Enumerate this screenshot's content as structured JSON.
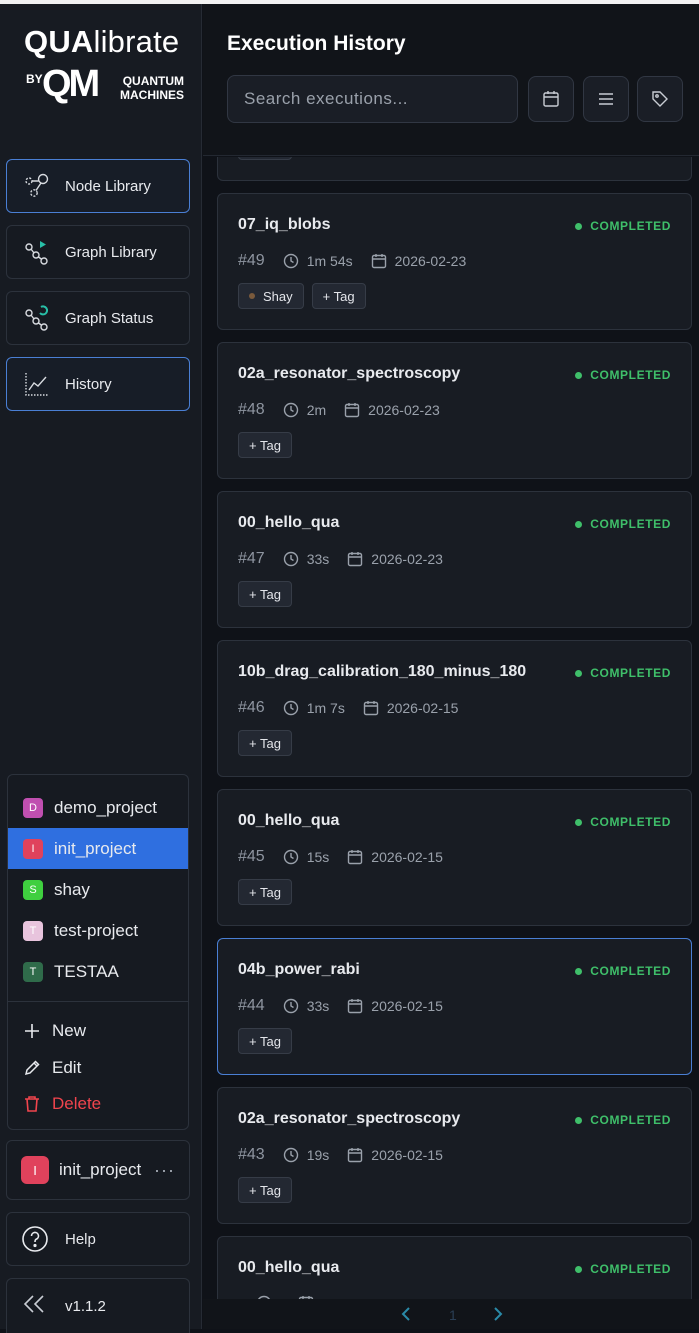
{
  "app": {
    "logo_main_bold": "QUA",
    "logo_main_rest": "librate",
    "logo_by": "BY",
    "logo_mark": "QM",
    "logo_sub_1": "QUANTUM",
    "logo_sub_2": "MACHINES",
    "version": "v1.1.2"
  },
  "nav": [
    {
      "label": "Node Library",
      "icon": "node-library-icon",
      "active": true
    },
    {
      "label": "Graph Library",
      "icon": "graph-library-icon",
      "active": false
    },
    {
      "label": "Graph Status",
      "icon": "graph-status-icon",
      "active": false
    },
    {
      "label": "History",
      "icon": "history-chart-icon",
      "active": true
    }
  ],
  "projects": {
    "items": [
      {
        "letter": "D",
        "name": "demo_project",
        "color": "#c04fb0"
      },
      {
        "letter": "I",
        "name": "init_project",
        "color": "#e0425c",
        "selected": true
      },
      {
        "letter": "S",
        "name": "shay",
        "color": "#3fcf3f"
      },
      {
        "letter": "T",
        "name": "test-project",
        "color": "#e8c4dd"
      },
      {
        "letter": "T",
        "name": "TESTAA",
        "color": "#2f6b4a"
      }
    ],
    "actions": {
      "new": "New",
      "edit": "Edit",
      "delete": "Delete"
    },
    "current": {
      "letter": "I",
      "name": "init_project",
      "color": "#e0425c",
      "more": "···"
    }
  },
  "help_label": "Help",
  "header": {
    "title": "Execution History",
    "search_placeholder": "Search executions..."
  },
  "executions": [
    {
      "name": "07_iq_blobs",
      "status": "COMPLETED",
      "number": "#49",
      "duration": "1m 54s",
      "date": "2026-02-23",
      "tags": [
        "Shay"
      ],
      "add_tag": "+ Tag"
    },
    {
      "name": "02a_resonator_spectroscopy",
      "status": "COMPLETED",
      "number": "#48",
      "duration": "2m",
      "date": "2026-02-23",
      "tags": [],
      "add_tag": "+ Tag"
    },
    {
      "name": "00_hello_qua",
      "status": "COMPLETED",
      "number": "#47",
      "duration": "33s",
      "date": "2026-02-23",
      "tags": [],
      "add_tag": "+ Tag"
    },
    {
      "name": "10b_drag_calibration_180_minus_180",
      "status": "COMPLETED",
      "number": "#46",
      "duration": "1m 7s",
      "date": "2026-02-15",
      "tags": [],
      "add_tag": "+ Tag"
    },
    {
      "name": "00_hello_qua",
      "status": "COMPLETED",
      "number": "#45",
      "duration": "15s",
      "date": "2026-02-15",
      "tags": [],
      "add_tag": "+ Tag"
    },
    {
      "name": "04b_power_rabi",
      "status": "COMPLETED",
      "number": "#44",
      "duration": "33s",
      "date": "2026-02-15",
      "tags": [],
      "add_tag": "+ Tag",
      "selected": true
    },
    {
      "name": "02a_resonator_spectroscopy",
      "status": "COMPLETED",
      "number": "#43",
      "duration": "19s",
      "date": "2026-02-15",
      "tags": [],
      "add_tag": "+ Tag"
    },
    {
      "name": "00_hello_qua",
      "status": "COMPLETED",
      "number": "",
      "duration": "",
      "date": "",
      "tags": [],
      "add_tag": ""
    }
  ],
  "pager": {
    "current": "1"
  },
  "colors": {
    "accent": "#2f6fe0",
    "completed": "#3fbf6a",
    "danger": "#f0444d"
  }
}
